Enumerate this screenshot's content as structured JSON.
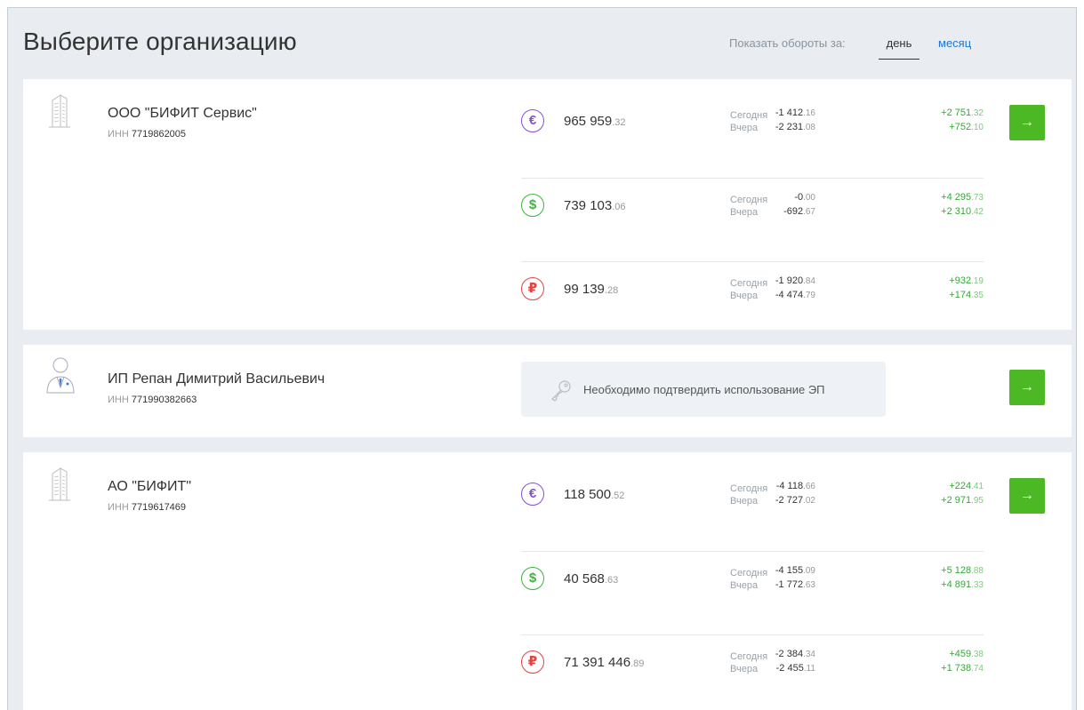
{
  "header": {
    "title": "Выберите организацию",
    "period_label": "Показать обороты за:",
    "tabs": [
      {
        "label": "день",
        "active": true
      },
      {
        "label": "месяц",
        "active": false
      }
    ]
  },
  "labels": {
    "today": "Сегодня",
    "yesterday": "Вчера",
    "inn_prefix": "ИНН"
  },
  "organizations": [
    {
      "name": "ООО \"БИФИТ Сервис\"",
      "inn": "7719862005",
      "icon": "building-icon",
      "accounts": [
        {
          "currency_icon": "euro-icon",
          "amount_int": "965 959",
          "amount_frac": ".32",
          "today_neg": {
            "int": "-1 412",
            "frac": ".16"
          },
          "yest_neg": {
            "int": "-2 231",
            "frac": ".08"
          },
          "today_pos": {
            "int": "+2 751",
            "frac": ".32"
          },
          "yest_pos": {
            "int": "+752",
            "frac": ".10"
          }
        },
        {
          "currency_icon": "dollar-icon",
          "amount_int": "739 103",
          "amount_frac": ".06",
          "today_neg": {
            "int": "-0",
            "frac": ".00"
          },
          "yest_neg": {
            "int": "-692",
            "frac": ".67"
          },
          "today_pos": {
            "int": "+4 295",
            "frac": ".73"
          },
          "yest_pos": {
            "int": "+2 310",
            "frac": ".42"
          }
        },
        {
          "currency_icon": "ruble-icon",
          "amount_int": "99 139",
          "amount_frac": ".28",
          "today_neg": {
            "int": "-1 920",
            "frac": ".84"
          },
          "yest_neg": {
            "int": "-4 474",
            "frac": ".79"
          },
          "today_pos": {
            "int": "+932",
            "frac": ".19"
          },
          "yest_pos": {
            "int": "+174",
            "frac": ".35"
          }
        }
      ]
    },
    {
      "name": "ИП Репан Димитрий Васильевич",
      "inn": "771990382663",
      "icon": "person-icon",
      "notice": "Необходимо подтвердить использование ЭП"
    },
    {
      "name": "АО \"БИФИТ\"",
      "inn": "7719617469",
      "icon": "building-icon",
      "accounts": [
        {
          "currency_icon": "euro-icon",
          "amount_int": "118 500",
          "amount_frac": ".52",
          "today_neg": {
            "int": "-4 118",
            "frac": ".66"
          },
          "yest_neg": {
            "int": "-2 727",
            "frac": ".02"
          },
          "today_pos": {
            "int": "+224",
            "frac": ".41"
          },
          "yest_pos": {
            "int": "+2 971",
            "frac": ".95"
          }
        },
        {
          "currency_icon": "dollar-icon",
          "amount_int": "40 568",
          "amount_frac": ".63",
          "today_neg": {
            "int": "-4 155",
            "frac": ".09"
          },
          "yest_neg": {
            "int": "-1 772",
            "frac": ".63"
          },
          "today_pos": {
            "int": "+5 128",
            "frac": ".88"
          },
          "yest_pos": {
            "int": "+4 891",
            "frac": ".33"
          }
        },
        {
          "currency_icon": "ruble-icon",
          "amount_int": "71 391 446",
          "amount_frac": ".89",
          "today_neg": {
            "int": "-2 384",
            "frac": ".34"
          },
          "yest_neg": {
            "int": "-2 455",
            "frac": ".11"
          },
          "today_pos": {
            "int": "+459",
            "frac": ".38"
          },
          "yest_pos": {
            "int": "+1 738",
            "frac": ".74"
          }
        }
      ]
    }
  ],
  "icons": {
    "currency": {
      "euro-icon": "€",
      "dollar-icon": "$",
      "ruble-icon": "₽"
    },
    "arrow": "→"
  },
  "colors": {
    "accent": "#4cb823",
    "link": "#1f77d0",
    "positive": "#35a835",
    "euro": "#8a4fd8",
    "dollar": "#3bb53b",
    "ruble": "#e04545"
  }
}
